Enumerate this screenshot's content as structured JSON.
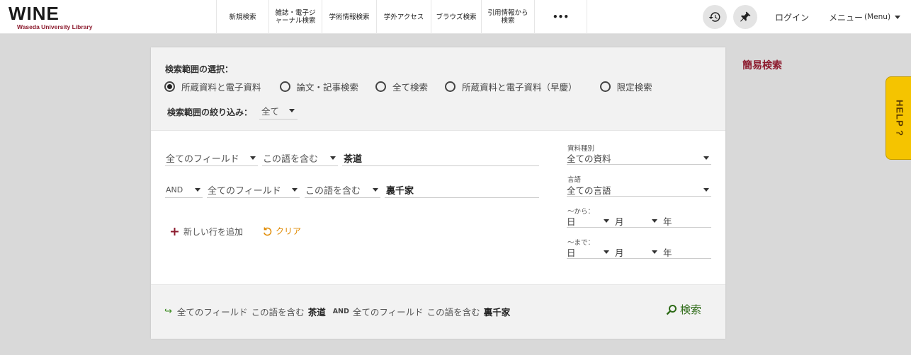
{
  "header": {
    "logo_title": "WINE",
    "logo_subtitle": "Waseda University Library",
    "nav": [
      {
        "label": "新規検索"
      },
      {
        "label": "雑誌・電子ジ\nャーナル検索"
      },
      {
        "label": "学術情報検索"
      },
      {
        "label": "学外アクセス"
      },
      {
        "label": "ブラウズ検索"
      },
      {
        "label": "引用情報から\n検索"
      },
      {
        "label": "•••"
      }
    ],
    "login_label": "ログイン",
    "menu_label": "メニュー",
    "menu_sub": "(Menu)"
  },
  "scope": {
    "title": "検索範囲の選択：",
    "options": [
      {
        "label": "所蔵資料と電子資料",
        "selected": true
      },
      {
        "label": "論文・記事検索",
        "selected": false
      },
      {
        "label": "全て検索",
        "selected": false
      },
      {
        "label": "所蔵資料と電子資料（早慶）",
        "selected": false
      },
      {
        "label": "限定検索",
        "selected": false
      }
    ],
    "refine_label": "検索範囲の絞り込み：",
    "refine_value": "全て"
  },
  "rows": [
    {
      "field": "全てのフィールド",
      "condition": "この語を含む",
      "term": "茶道"
    },
    {
      "operator": "AND",
      "field": "全てのフィールド",
      "condition": "この語を含む",
      "term": "裏千家"
    }
  ],
  "actions": {
    "add_row": "新しい行を追加",
    "clear": "クリア"
  },
  "filters": {
    "material_label": "資料種別",
    "material_value": "全ての資料",
    "language_label": "言語",
    "language_value": "全ての言語",
    "from_label": "～から：",
    "to_label": "～まで：",
    "day": "日",
    "month": "月",
    "year": "年"
  },
  "summary": {
    "arrow": "↪",
    "parts": [
      {
        "text": "全てのフィールド"
      },
      {
        "text": "この語を含む"
      },
      {
        "term": "茶道"
      },
      {
        "op": "AND"
      },
      {
        "text": "全てのフィールド"
      },
      {
        "text": "この語を含む"
      },
      {
        "term": "裏千家"
      }
    ],
    "search_label": "検索"
  },
  "sidebar": {
    "simple_search": "簡易検索",
    "help": "HELP ?"
  },
  "colors": {
    "brand": "#8c1b2e",
    "accent_orange": "#e08a00",
    "search_green": "#2e6b18",
    "help_yellow": "#f5c400"
  },
  "icons": [
    "history-icon",
    "pin-icon",
    "plus-icon",
    "undo-icon",
    "search-icon"
  ]
}
